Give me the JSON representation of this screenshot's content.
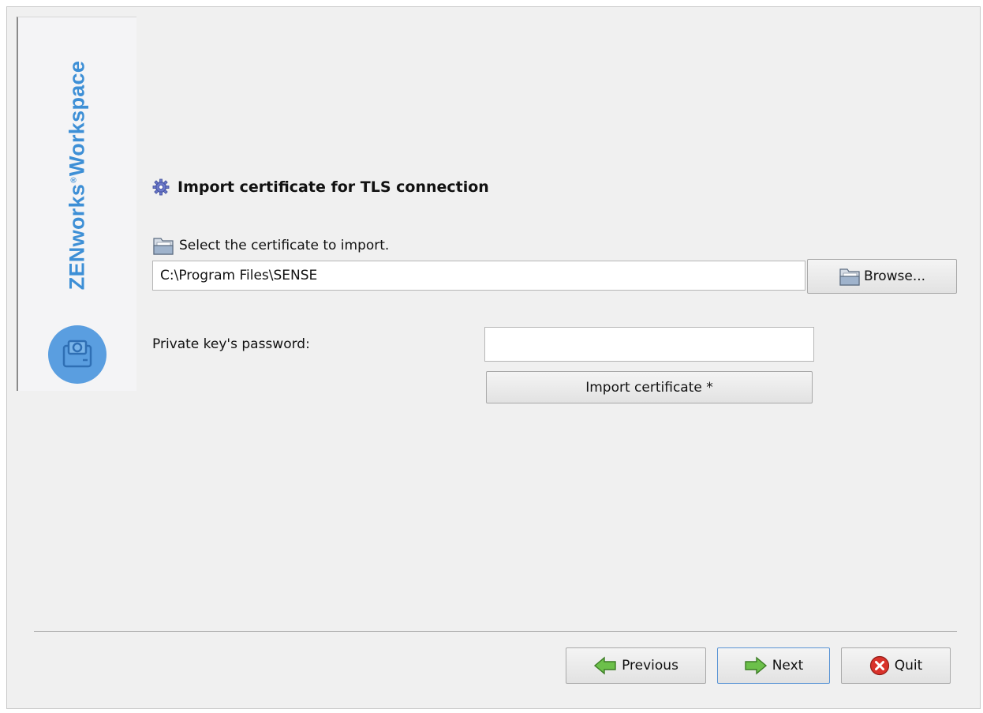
{
  "brand": {
    "name_part1": "ZENworks",
    "registered_mark": "®",
    "name_part2": "Workspace"
  },
  "section": {
    "title": "Import certificate for TLS connection"
  },
  "certificate": {
    "select_label": "Select the certificate to import.",
    "path_value": "C:\\Program Files\\SENSE",
    "browse_label": "Browse..."
  },
  "password": {
    "label": "Private key's password:",
    "value": ""
  },
  "import_button_label": "Import certificate *",
  "nav": {
    "previous_label": "Previous",
    "next_label": "Next",
    "quit_label": "Quit"
  },
  "colors": {
    "brand_blue": "#3d8fd6",
    "arrow_green": "#6cc04a",
    "quit_red": "#d9322b",
    "focus_blue": "#5b95d5"
  },
  "icons": [
    "gear-icon",
    "folder-icon",
    "arrow-left-icon",
    "arrow-right-icon",
    "close-circle-icon",
    "zenworks-logo-icon"
  ]
}
